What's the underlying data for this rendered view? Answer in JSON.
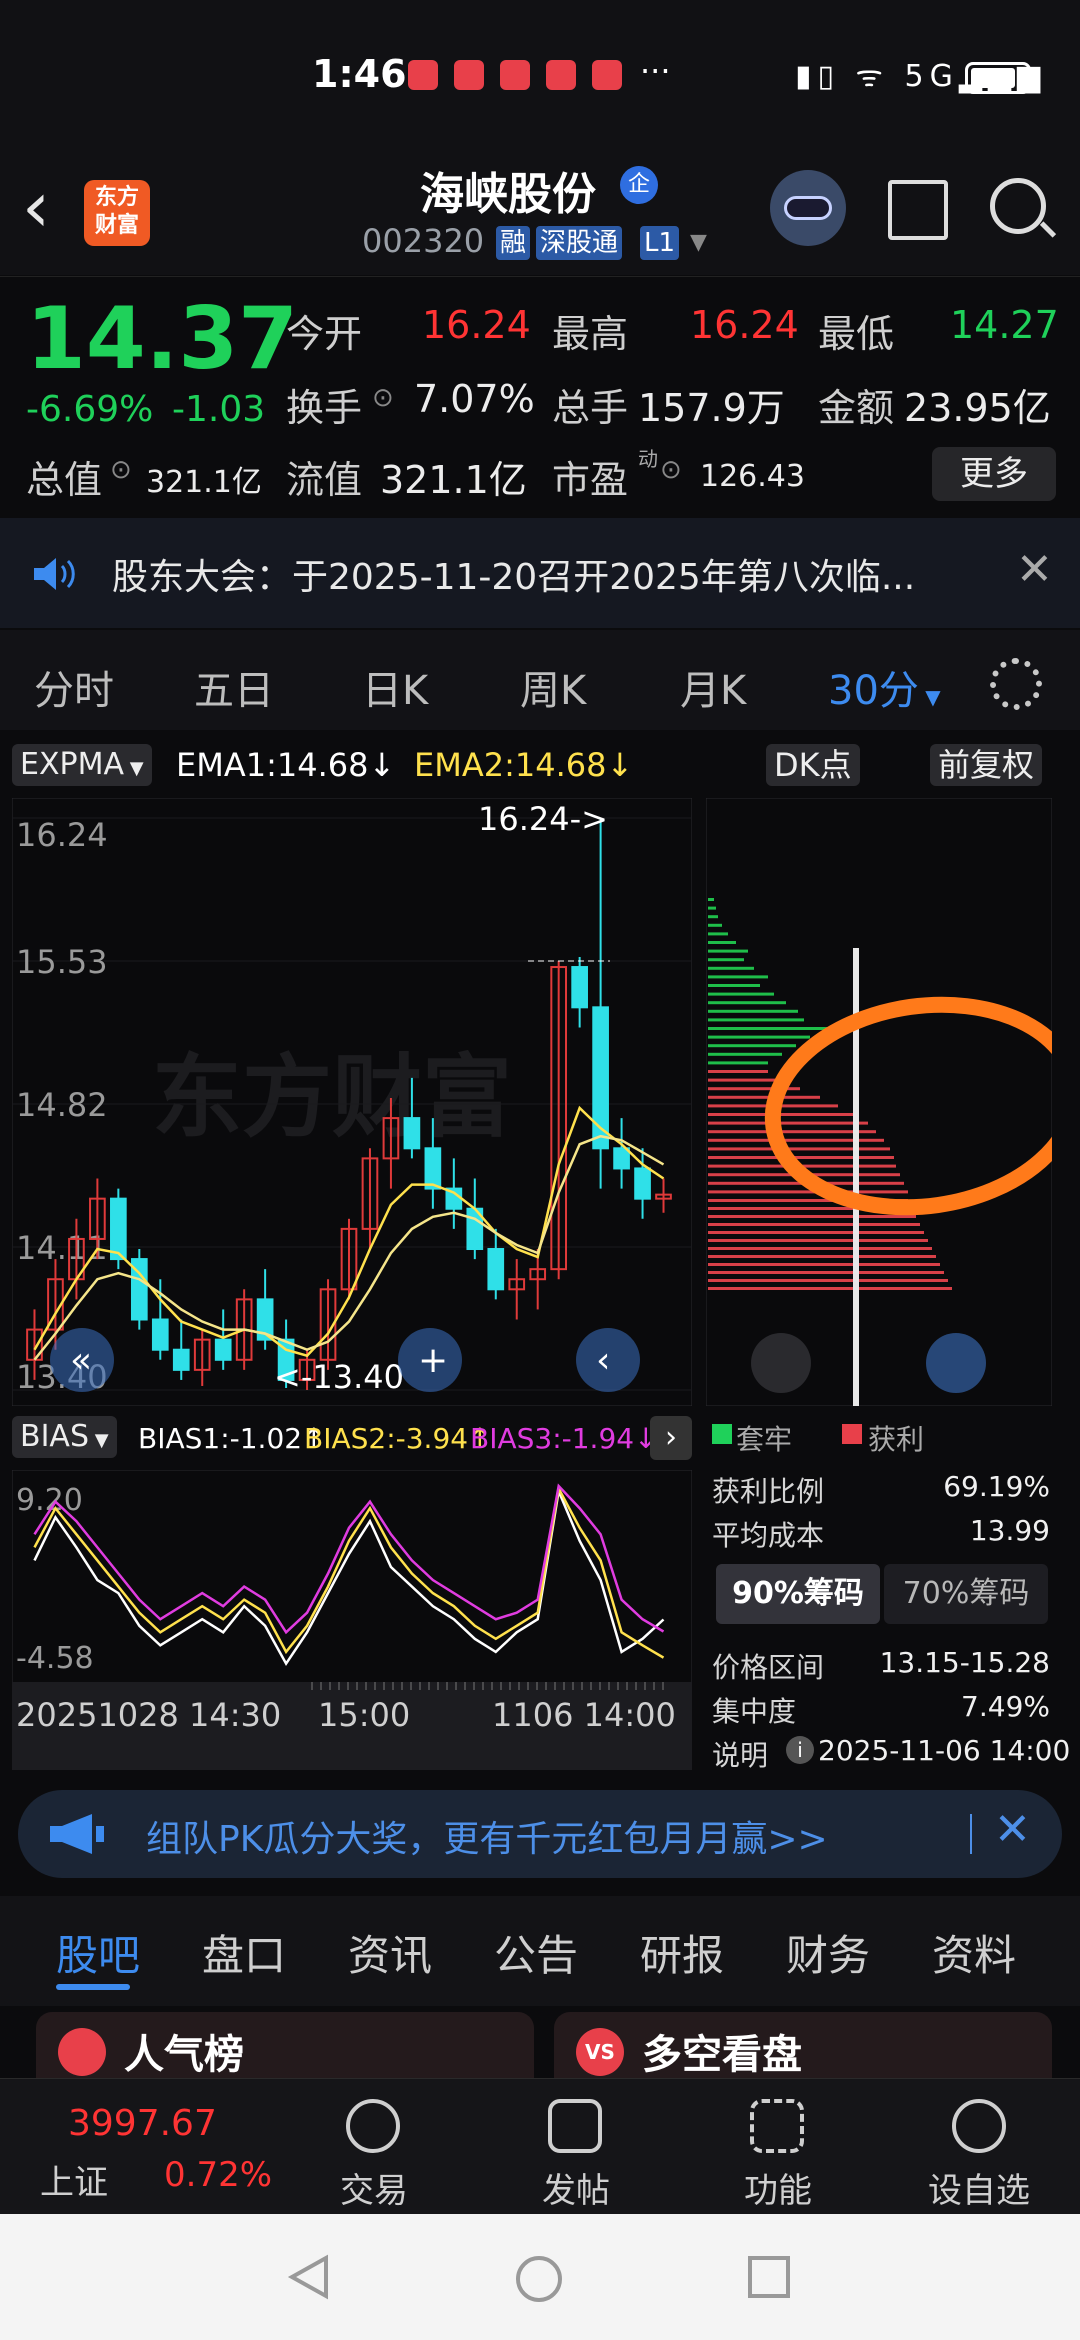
{
  "status": {
    "time": "1:46",
    "dots": "···",
    "network": "5G"
  },
  "header": {
    "name": "海峡股份",
    "badge": "企",
    "code": "002320",
    "tags": [
      "融",
      "深股通",
      "L1"
    ],
    "logo": "东方\n财富"
  },
  "quote": {
    "price": "14.37",
    "pct": "-6.69%",
    "chg": "-1.03",
    "open_label": "今开",
    "open": "16.24",
    "high_label": "最高",
    "high": "16.24",
    "low_label": "最低",
    "low": "14.27",
    "turnover_label": "换手",
    "turnover": "7.07%",
    "volume_label": "总手",
    "volume": "157.9万",
    "amount_label": "金额",
    "amount": "23.95亿",
    "mcap_label": "总值",
    "mcap": "321.1亿",
    "float_label": "流值",
    "float": "321.1亿",
    "pe_label": "市盈",
    "pe_sup": "动",
    "pe": "126.43",
    "more": "更多"
  },
  "notice": {
    "text": "股东大会：于2025-11-20召开2025年第八次临..."
  },
  "ktabs": [
    "分时",
    "五日",
    "日K",
    "周K",
    "月K",
    "30分"
  ],
  "indicator": {
    "name": "EXPMA",
    "ema1": "EMA1:14.68",
    "ema2": "EMA2:14.68",
    "dk": "DK点",
    "adj": "前复权"
  },
  "chart_data": [
    {
      "type": "candlestick",
      "ylim": [
        13.4,
        16.24
      ],
      "y_ticks": [
        "16.24",
        "15.53",
        "14.82",
        "14.11",
        "13.40"
      ],
      "annotations": [
        "16.24->",
        "<-13.40"
      ],
      "watermark": "东方财富",
      "candles": [
        [
          13.55,
          13.8,
          13.45,
          13.7
        ],
        [
          13.7,
          14.05,
          13.6,
          13.95
        ],
        [
          13.95,
          14.25,
          13.85,
          14.15
        ],
        [
          14.15,
          14.45,
          14.05,
          14.35
        ],
        [
          14.35,
          14.4,
          14.0,
          14.05
        ],
        [
          14.05,
          14.1,
          13.7,
          13.75
        ],
        [
          13.75,
          13.95,
          13.55,
          13.6
        ],
        [
          13.6,
          13.75,
          13.45,
          13.5
        ],
        [
          13.5,
          13.7,
          13.42,
          13.65
        ],
        [
          13.65,
          13.8,
          13.5,
          13.55
        ],
        [
          13.55,
          13.9,
          13.5,
          13.85
        ],
        [
          13.85,
          14.0,
          13.6,
          13.65
        ],
        [
          13.65,
          13.75,
          13.41,
          13.45
        ],
        [
          13.45,
          13.6,
          13.4,
          13.55
        ],
        [
          13.55,
          13.95,
          13.5,
          13.9
        ],
        [
          13.9,
          14.25,
          13.85,
          14.2
        ],
        [
          14.2,
          14.6,
          14.1,
          14.55
        ],
        [
          14.55,
          14.85,
          14.4,
          14.75
        ],
        [
          14.75,
          14.95,
          14.55,
          14.6
        ],
        [
          14.6,
          14.75,
          14.3,
          14.4
        ],
        [
          14.4,
          14.55,
          14.2,
          14.3
        ],
        [
          14.3,
          14.45,
          14.05,
          14.1
        ],
        [
          14.1,
          14.2,
          13.85,
          13.9
        ],
        [
          13.9,
          14.05,
          13.75,
          13.95
        ],
        [
          13.95,
          14.1,
          13.8,
          14.0
        ],
        [
          14.0,
          15.53,
          13.95,
          15.5
        ],
        [
          15.5,
          15.55,
          15.2,
          15.3
        ],
        [
          15.3,
          16.24,
          14.4,
          14.6
        ],
        [
          14.6,
          14.75,
          14.4,
          14.5
        ],
        [
          14.5,
          14.6,
          14.25,
          14.35
        ],
        [
          14.35,
          14.45,
          14.28,
          14.37
        ]
      ],
      "ema1": [
        13.6,
        13.78,
        13.95,
        14.1,
        14.08,
        13.98,
        13.85,
        13.74,
        13.7,
        13.66,
        13.7,
        13.68,
        13.6,
        13.57,
        13.68,
        13.86,
        14.1,
        14.32,
        14.42,
        14.42,
        14.38,
        14.3,
        14.18,
        14.1,
        14.06,
        14.52,
        14.8,
        14.7,
        14.62,
        14.52,
        14.45
      ],
      "ema2": [
        13.55,
        13.68,
        13.82,
        13.95,
        13.98,
        13.95,
        13.88,
        13.8,
        13.74,
        13.7,
        13.7,
        13.68,
        13.64,
        13.6,
        13.64,
        13.74,
        13.9,
        14.08,
        14.2,
        14.26,
        14.28,
        14.25,
        14.18,
        14.12,
        14.08,
        14.38,
        14.62,
        14.66,
        14.64,
        14.58,
        14.52
      ]
    },
    {
      "type": "line",
      "name": "BIAS",
      "ylim": [
        -4.58,
        9.2
      ],
      "y_ticks": [
        "9.20",
        "-4.58"
      ],
      "series": [
        {
          "name": "BIAS1:-1.02",
          "values": [
            3.5,
            6.8,
            4.5,
            2.0,
            1.0,
            -1.5,
            -3.0,
            -2.0,
            -1.0,
            -2.0,
            0.0,
            -1.5,
            -4.4,
            -2.0,
            1.0,
            4.0,
            6.5,
            3.0,
            1.5,
            0.0,
            -1.0,
            -2.5,
            -3.5,
            -2.0,
            -1.0,
            8.8,
            5.0,
            2.0,
            -3.5,
            -2.5,
            -1.02
          ]
        },
        {
          "name": "BIAS2:-3.94",
          "values": [
            4.5,
            7.5,
            5.5,
            3.5,
            1.5,
            -0.5,
            -2.0,
            -1.0,
            0.0,
            -1.0,
            0.5,
            -0.5,
            -3.5,
            -1.5,
            1.5,
            5.0,
            7.5,
            4.5,
            2.5,
            1.0,
            0.0,
            -1.5,
            -2.5,
            -1.5,
            -0.5,
            9.0,
            6.0,
            3.5,
            -2.0,
            -3.0,
            -3.94
          ]
        },
        {
          "name": "BIAS3:-1.94",
          "values": [
            5.5,
            8.0,
            6.5,
            4.5,
            2.5,
            0.5,
            -1.0,
            0.0,
            1.0,
            0.0,
            1.5,
            0.5,
            -2.0,
            -0.5,
            2.5,
            6.0,
            8.0,
            5.5,
            3.5,
            2.0,
            1.0,
            0.0,
            -1.0,
            -0.5,
            0.5,
            9.2,
            7.5,
            5.5,
            0.5,
            -1.0,
            -1.94
          ]
        }
      ],
      "x_labels": [
        "20251028 14:30",
        "15:00",
        "1106 14:00"
      ]
    },
    {
      "type": "bar",
      "name": "chips",
      "legend": [
        "套牢",
        "获利"
      ],
      "green_levels": [
        6,
        8,
        10,
        14,
        20,
        28,
        40,
        36,
        46,
        60,
        52,
        66,
        78,
        90,
        96,
        120,
        102,
        88,
        74,
        60
      ],
      "red_levels": [
        60,
        76,
        92,
        112,
        130,
        150,
        160,
        168,
        176,
        182,
        186,
        188,
        192,
        196,
        200
      ]
    }
  ],
  "bias": {
    "name": "BIAS",
    "b1": "BIAS1:-1.02↑",
    "b2": "BIAS2:-3.94↑",
    "b3": "BIAS3:-1.94↓"
  },
  "chips": {
    "legend_green": "套牢",
    "legend_red": "获利",
    "profit_label": "获利比例",
    "profit": "69.19%",
    "avg_label": "平均成本",
    "avg": "13.99",
    "btn90": "90%筹码",
    "btn70": "70%筹码",
    "range_label": "价格区间",
    "range": "13.15-15.28",
    "conc_label": "集中度",
    "conc": "7.49%",
    "note_label": "说明",
    "note": "2025-11-06 14:00"
  },
  "promo": {
    "text": "组队PK瓜分大奖，更有千元红包月月赢>>"
  },
  "btabs": [
    "股吧",
    "盘口",
    "资讯",
    "公告",
    "研报",
    "财务",
    "资料"
  ],
  "cards": {
    "left": "人气榜",
    "right": "多空看盘"
  },
  "nav": {
    "index_value": "3997.67",
    "index_name": "上证",
    "index_pct": "0.72%",
    "items": [
      "交易",
      "发帖",
      "功能",
      "设自选"
    ]
  }
}
